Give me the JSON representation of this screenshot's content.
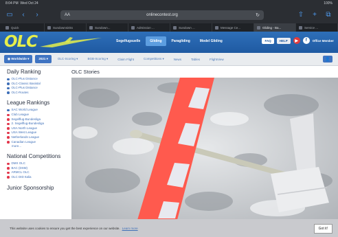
{
  "status": {
    "time": "8:04 PM",
    "date": "Wed Oct 24",
    "battery": "100%"
  },
  "browser": {
    "url": "onlinecontest.org",
    "aa": "AA",
    "reload": "↻"
  },
  "tabs": [
    {
      "label": "Quick"
    },
    {
      "label": "Sundownsinks"
    },
    {
      "label": "Sundown..."
    },
    {
      "label": "Admission ..."
    },
    {
      "label": "Sundown ..."
    },
    {
      "label": "Message Ce..."
    },
    {
      "label": "Gliding - Ba..."
    },
    {
      "label": "Service ..."
    }
  ],
  "header": {
    "logo": "OLC",
    "nav": [
      "Segelfugsuelle",
      "Gliding",
      "Paragliding",
      "Model Gliding"
    ],
    "active_nav": "Gliding",
    "faq": "FAQ",
    "help": "HELP",
    "office": "Office Member"
  },
  "subnav": {
    "worldwide": "Worldwide",
    "year": "2021",
    "menus": [
      "OLC-Scoring",
      "BGB-Scoring",
      "Claim Flight",
      "Competitions",
      "News",
      "Tables",
      "FlightView"
    ]
  },
  "sidebar": {
    "daily_title": "Daily Ranking",
    "daily": [
      {
        "label": "OLC-Plus Distance",
        "color": "#3e6fb8"
      },
      {
        "label": "OLC-Classic Basistal",
        "color": "#3e6fb8"
      },
      {
        "label": "OLC-Plus Distance",
        "color": "#3e6fb8"
      },
      {
        "label": "OLC-Routes",
        "color": "#3e6fb8"
      }
    ],
    "league_title": "League Rankings",
    "league": [
      {
        "label": "SAC World League",
        "color": "#3e6fb8"
      },
      {
        "label": "Club League",
        "color": "#e2364b"
      },
      {
        "label": "Segelflug-Bundesliga",
        "color": "#e2364b"
      },
      {
        "label": "2. Segelflug-Bundesliga",
        "color": "#e2364b"
      },
      {
        "label": "USA North League",
        "color": "#e2364b"
      },
      {
        "label": "USA West League",
        "color": "#e2364b"
      },
      {
        "label": "Netherlands League",
        "color": "#e2364b"
      },
      {
        "label": "Canadian League",
        "color": "#e2364b"
      }
    ],
    "league_more": "more...",
    "national_title": "National Competitions",
    "national": [
      {
        "label": "DMX OLC",
        "color": "#e2364b"
      },
      {
        "label": "BAC (DSM)",
        "color": "#e2364b"
      },
      {
        "label": "ARMCL OLC",
        "color": "#e2364b"
      },
      {
        "label": "OLC DID Italia",
        "color": "#e2364b"
      }
    ],
    "junior_title": "Junior Sponsorship"
  },
  "main": {
    "title": "OLC Stories"
  },
  "cookie": {
    "text": "This website uses cookies to ensure you get the best experience on our website.",
    "link": "Learn more",
    "button": "Got it!"
  }
}
